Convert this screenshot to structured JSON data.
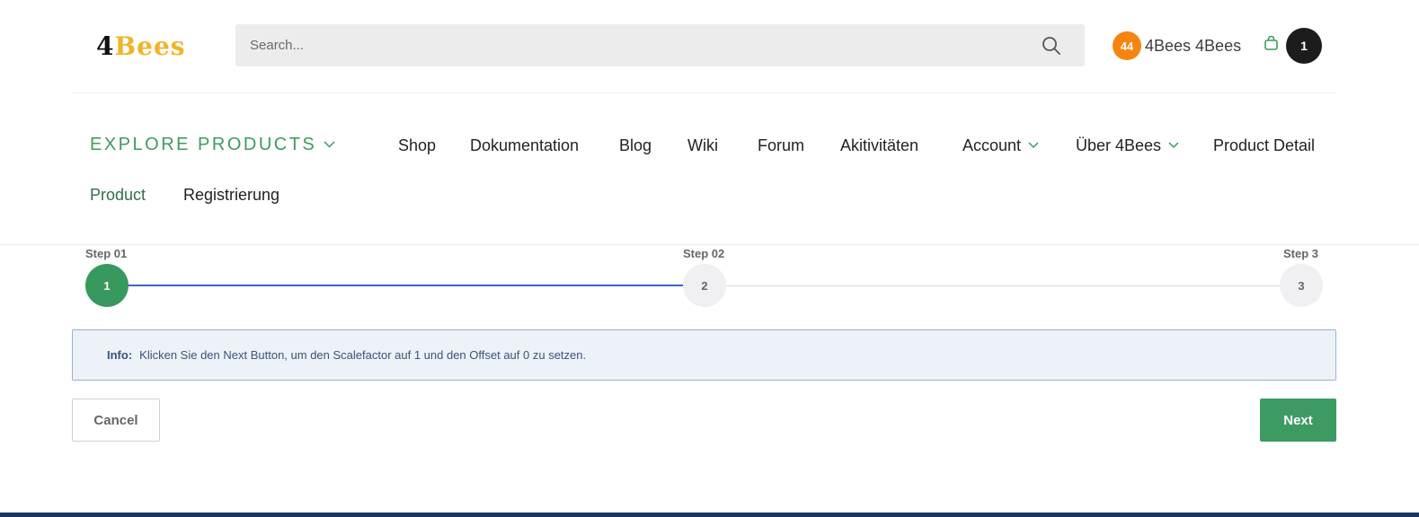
{
  "header": {
    "logo": {
      "num": "4",
      "word": "Bees"
    },
    "search": {
      "placeholder": "Search..."
    },
    "user": {
      "badge_count": "44",
      "name": "4Bees 4Bees"
    },
    "cart": {
      "count": "1"
    },
    "colors": {
      "accent_green": "#3d9b62",
      "badge_orange": "#f5850f",
      "logo_gold": "#f0b429"
    }
  },
  "nav": {
    "explore": "EXPLORE PRODUCTS",
    "items": [
      {
        "label": "Shop"
      },
      {
        "label": "Dokumentation"
      },
      {
        "label": "Blog"
      },
      {
        "label": "Wiki"
      },
      {
        "label": "Forum"
      },
      {
        "label": "Akitivitäten"
      },
      {
        "label": "Account",
        "dropdown": true
      },
      {
        "label": "Über 4Bees",
        "dropdown": true
      },
      {
        "label": "Product Detail"
      },
      {
        "label": "Product",
        "active": true
      },
      {
        "label": "Registrierung"
      }
    ]
  },
  "stepper": {
    "steps": [
      {
        "label": "Step 01",
        "number": "1",
        "state": "done"
      },
      {
        "label": "Step 02",
        "number": "2",
        "state": "todo"
      },
      {
        "label": "Step 3",
        "number": "3",
        "state": "todo"
      }
    ]
  },
  "info": {
    "label": "Info:",
    "text": "Klicken Sie den Next Button, um den Scalefactor auf 1 und den Offset auf 0 zu setzen."
  },
  "actions": {
    "cancel": "Cancel",
    "next": "Next"
  }
}
